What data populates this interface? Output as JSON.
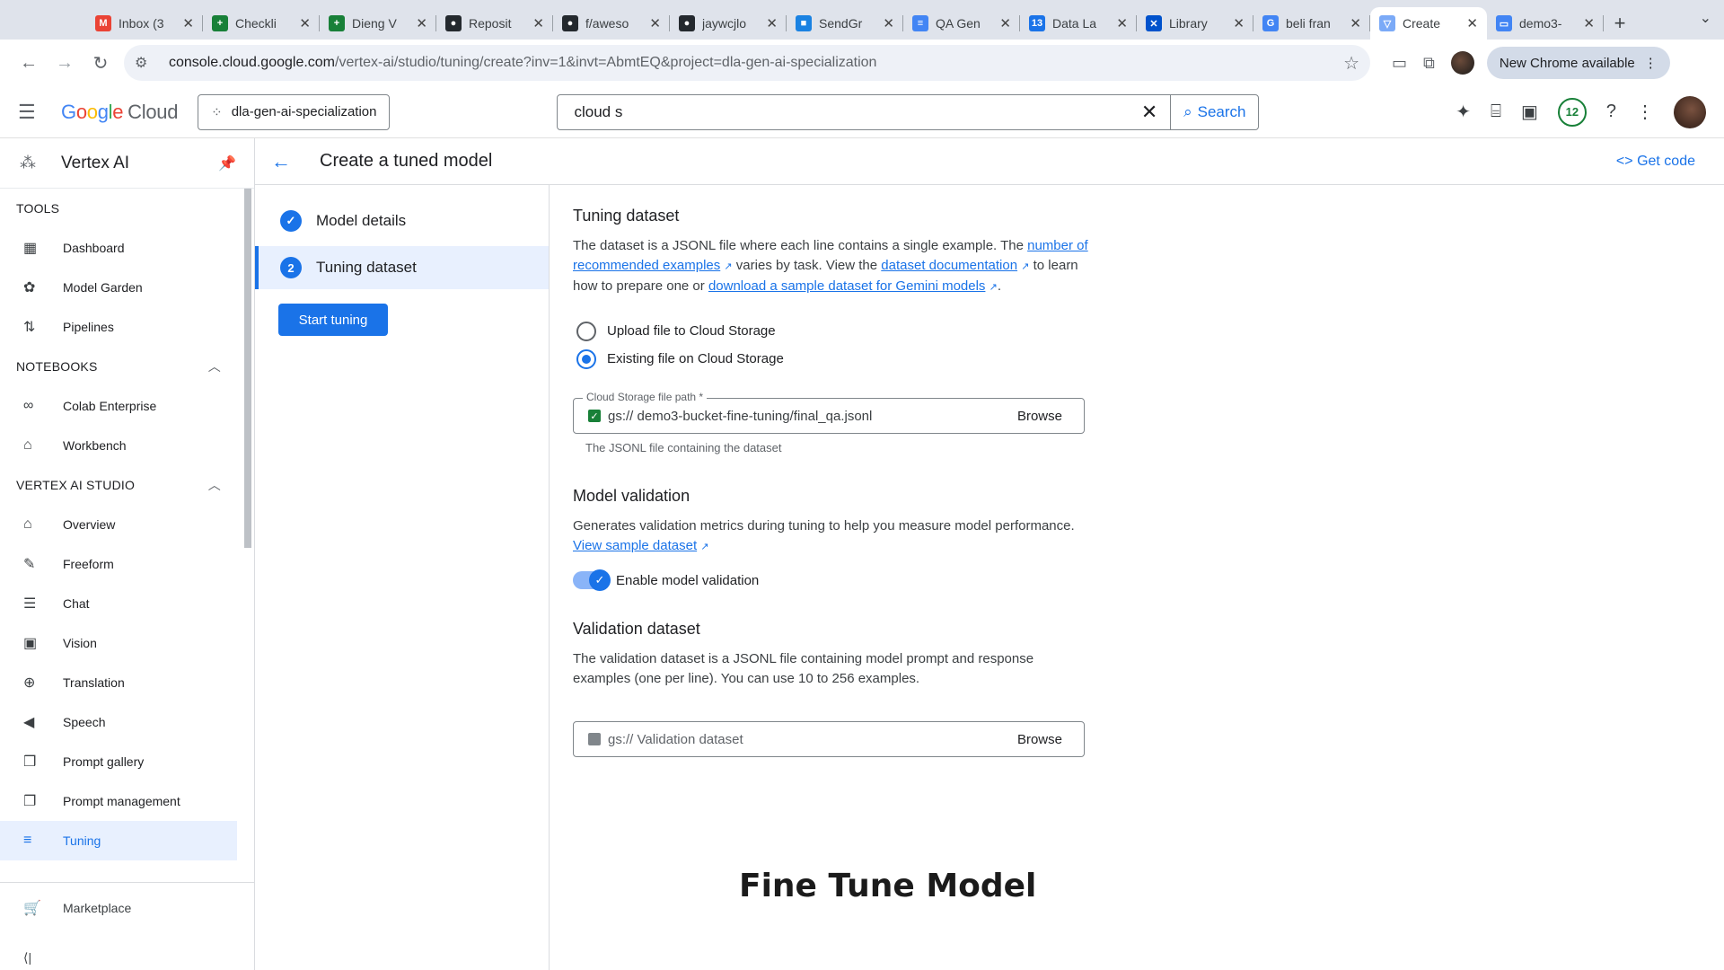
{
  "browser": {
    "tabs": [
      {
        "label": "Inbox (3",
        "icon": "gmail-icon",
        "color": "#ea4335",
        "glyph": "M"
      },
      {
        "label": "Checkli",
        "icon": "sheets-icon",
        "color": "#188038",
        "glyph": "+"
      },
      {
        "label": "Dieng V",
        "icon": "sheets-icon",
        "color": "#188038",
        "glyph": "+"
      },
      {
        "label": "Reposit",
        "icon": "github-icon",
        "color": "#24292e",
        "glyph": "●"
      },
      {
        "label": "f/aweso",
        "icon": "github-icon",
        "color": "#24292e",
        "glyph": "●"
      },
      {
        "label": "jaywcjlo",
        "icon": "github-icon",
        "color": "#24292e",
        "glyph": "●"
      },
      {
        "label": "SendGr",
        "icon": "sendgrid-icon",
        "color": "#1a82e2",
        "glyph": "■"
      },
      {
        "label": "QA Gen",
        "icon": "docs-icon",
        "color": "#4285f4",
        "glyph": "≡"
      },
      {
        "label": "Data La",
        "icon": "calendar-icon",
        "color": "#1a73e8",
        "glyph": "13"
      },
      {
        "label": "Library",
        "icon": "confluence-icon",
        "color": "#0052cc",
        "glyph": "✕"
      },
      {
        "label": "beli fran",
        "icon": "google-icon",
        "color": "#4285f4",
        "glyph": "G"
      },
      {
        "label": "Create",
        "icon": "vertex-icon",
        "color": "#7baaf7",
        "glyph": "▽",
        "active": true
      },
      {
        "label": "demo3-",
        "icon": "storage-icon",
        "color": "#4285f4",
        "glyph": "▭"
      }
    ],
    "url_host": "console.cloud.google.com",
    "url_path": "/vertex-ai/studio/tuning/create?inv=1&invt=AbmtEQ&project=dla-gen-ai-specialization",
    "new_chrome": "New Chrome available"
  },
  "header": {
    "logo_word": "Google",
    "logo_cloud": "Cloud",
    "project": "dla-gen-ai-specialization",
    "search_query": "cloud s",
    "search_button": "Search",
    "notif_count": "12"
  },
  "sidebar": {
    "title": "Vertex AI",
    "sections": {
      "tools": "TOOLS",
      "notebooks": "NOTEBOOKS",
      "studio": "VERTEX AI STUDIO"
    },
    "tools": [
      {
        "label": "Dashboard",
        "icon": "dashboard-icon",
        "glyph": "▦"
      },
      {
        "label": "Model Garden",
        "icon": "model-garden-icon",
        "glyph": "✿"
      },
      {
        "label": "Pipelines",
        "icon": "pipelines-icon",
        "glyph": "⇅"
      }
    ],
    "notebooks": [
      {
        "label": "Colab Enterprise",
        "icon": "colab-icon",
        "glyph": "∞"
      },
      {
        "label": "Workbench",
        "icon": "workbench-icon",
        "glyph": "⌂"
      }
    ],
    "studio": [
      {
        "label": "Overview",
        "icon": "home-icon",
        "glyph": "⌂"
      },
      {
        "label": "Freeform",
        "icon": "freeform-icon",
        "glyph": "✎"
      },
      {
        "label": "Chat",
        "icon": "chat-icon",
        "glyph": "☰"
      },
      {
        "label": "Vision",
        "icon": "vision-icon",
        "glyph": "▣"
      },
      {
        "label": "Translation",
        "icon": "translation-icon",
        "glyph": "⊕"
      },
      {
        "label": "Speech",
        "icon": "speech-icon",
        "glyph": "◀"
      },
      {
        "label": "Prompt gallery",
        "icon": "prompt-gallery-icon",
        "glyph": "❒"
      },
      {
        "label": "Prompt management",
        "icon": "prompt-management-icon",
        "glyph": "❐"
      },
      {
        "label": "Tuning",
        "icon": "tuning-icon",
        "glyph": "≡",
        "active": true
      }
    ],
    "marketplace": "Marketplace"
  },
  "page": {
    "title": "Create a tuned model",
    "get_code": "Get code",
    "steps": [
      {
        "label": "Model details",
        "num": "✓"
      },
      {
        "label": "Tuning dataset",
        "num": "2"
      }
    ],
    "start_tuning": "Start tuning"
  },
  "form": {
    "tuning": {
      "heading": "Tuning dataset",
      "p1": "The dataset is a JSONL file where each line contains a single example. The ",
      "link1": "number of recommended examples",
      "p2": " varies by task. View the ",
      "link2": "dataset documentation",
      "p3": " to learn how to prepare one or ",
      "link3": "download a sample dataset for Gemini models",
      "p4": ".",
      "radio_upload": "Upload file to Cloud Storage",
      "radio_existing": "Existing file on Cloud Storage",
      "path_label": "Cloud Storage file path *",
      "path_value": "gs:// demo3-bucket-fine-tuning/final_qa.jsonl",
      "browse": "Browse",
      "path_hint": "The JSONL file containing the dataset"
    },
    "validation": {
      "heading": "Model validation",
      "p1": "Generates validation metrics during tuning to help you measure model performance. ",
      "link": "View sample dataset",
      "toggle_label": "Enable model validation"
    },
    "validation_dataset": {
      "heading": "Validation dataset",
      "p": "The validation dataset is a JSONL file containing model prompt and response examples (one per line). You can use 10 to 256 examples.",
      "placeholder": "gs:// Validation dataset",
      "browse": "Browse"
    }
  },
  "overlay_title": "Fine Tune Model"
}
